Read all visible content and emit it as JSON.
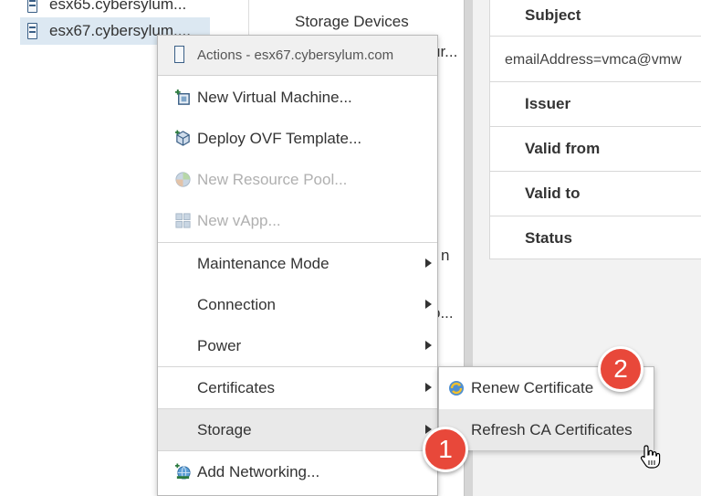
{
  "tree": {
    "hosts": [
      {
        "label": "esx65.cybersylum..."
      },
      {
        "label": "esx67.cybersylum...."
      }
    ]
  },
  "midnav": {
    "storage_devices": "Storage Devices",
    "frag1": "ur...",
    "frag2": "n",
    "frag3": "o..."
  },
  "certificate": {
    "subject_label": "Subject",
    "subject_value": "emailAddress=vmca@vmw",
    "rows": [
      "Issuer",
      "Valid from",
      "Valid to",
      "Status"
    ]
  },
  "menu": {
    "header": "Actions - esx67.cybersylum.com",
    "items": [
      {
        "label": "New Virtual Machine...",
        "icon": "new-vm-icon"
      },
      {
        "label": "Deploy OVF Template...",
        "icon": "deploy-ovf-icon"
      },
      {
        "label": "New Resource Pool...",
        "icon": "resource-pool-icon"
      },
      {
        "label": "New vApp...",
        "icon": "vapp-icon"
      },
      {
        "label": "Maintenance Mode"
      },
      {
        "label": "Connection"
      },
      {
        "label": "Power"
      },
      {
        "label": "Certificates"
      },
      {
        "label": "Storage"
      },
      {
        "label": "Add Networking...",
        "icon": "add-networking-icon"
      }
    ]
  },
  "submenu": {
    "renew": "Renew Certificate",
    "refresh": "Refresh CA Certificates"
  },
  "callouts": {
    "one": "1",
    "two": "2"
  },
  "colors": {
    "badge": "#e8483a",
    "selection": "#dce8f2",
    "hover": "#e9e9e9"
  }
}
